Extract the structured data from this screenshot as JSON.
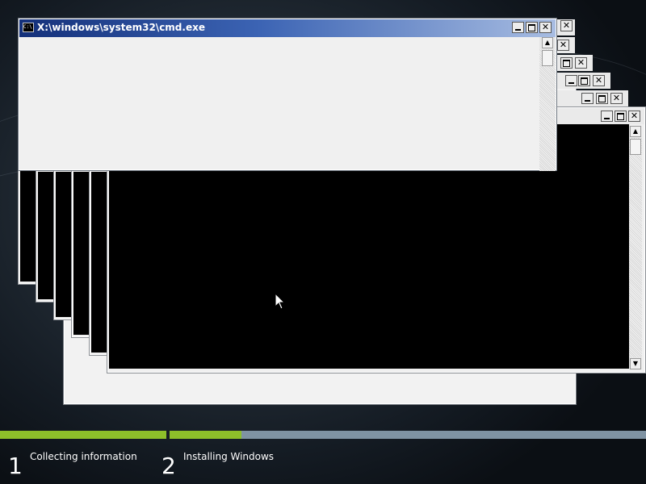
{
  "window": {
    "title": "X:\\windows\\system32\\cmd.exe",
    "icon": "cmd-icon",
    "icon_text": "C:\\",
    "buttons": {
      "minimize": "minimize-icon",
      "maximize": "maximize-icon",
      "close": "close-icon"
    },
    "close_glyph": "✕"
  },
  "scroll_arrows": {
    "up": "▲",
    "down": "▼"
  },
  "setup": {
    "steps": [
      {
        "number": "1",
        "label": "Collecting information"
      },
      {
        "number": "2",
        "label": "Installing Windows"
      }
    ],
    "progress": {
      "step1_fraction": 1.0,
      "step2_fraction": 0.15
    }
  },
  "colors": {
    "accent_progress": "#8dbf2a",
    "title_bar_start": "#14307a",
    "console_bg": "#000000"
  }
}
